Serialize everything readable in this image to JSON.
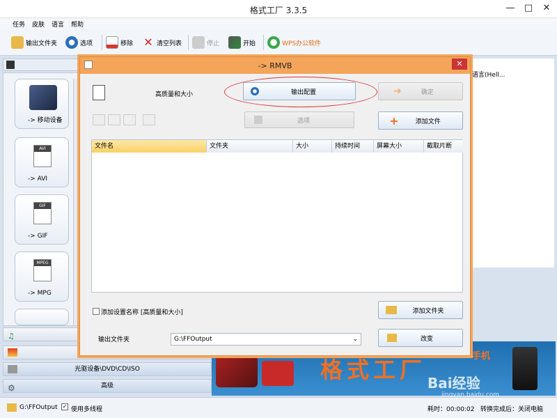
{
  "window": {
    "title": "格式工厂 3.3.5",
    "min": "—",
    "max": "□",
    "close": "✕"
  },
  "menu": [
    "任务",
    "皮肤",
    "语言",
    "帮助"
  ],
  "toolbar": {
    "output_folder": "输出文件夹",
    "options": "选项",
    "remove": "移除",
    "clear_list": "清空列表",
    "stop": "停止",
    "start": "开始",
    "wps": "WPS办公软件"
  },
  "left": {
    "cards": [
      "-> 移动设备",
      "-> AVI",
      "-> GIF",
      "-> MPG"
    ],
    "card_icons": [
      "",
      "AVI",
      "GIF",
      "MPEG"
    ],
    "categories": [
      "光驱设备\\DVD\\CD\\ISO",
      "高级"
    ]
  },
  "right_snippet": "语言(Hell...",
  "dialog": {
    "title": "-> RMVB",
    "quality": "高质量和大小",
    "output_config": "输出配置",
    "ok": "确定",
    "options": "选项",
    "add_file": "添加文件",
    "columns": [
      "文件名",
      "文件夹",
      "大小",
      "持续时间",
      "屏幕大小",
      "截取片断"
    ],
    "checkbox_label": "添加设置名称 [高质量和大小]",
    "add_folder": "添加文件夹",
    "output_folder_label": "输出文件夹",
    "output_folder_value": "G:\\FFOutput",
    "change": "改变",
    "close": "✕"
  },
  "banner": {
    "brand": "格式工厂",
    "phone": "手机"
  },
  "status": {
    "path": "G:\\FFOutput",
    "multithread": "使用多线程",
    "elapsed": "耗时：00:00:02",
    "after_done": "转换完成后：关闭电脑"
  },
  "watermark": {
    "site": "Bai经验",
    "url": "jingyan.baidu.com"
  }
}
